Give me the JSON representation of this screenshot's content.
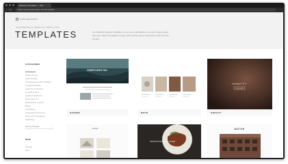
{
  "browser": {
    "tab_title": "Website Templates — Squ",
    "nav_icons": "‹ › ↻",
    "url": "https://www.squarespace.com/templates"
  },
  "header": {
    "logo_text": "SQUARESPACE",
    "eyebrow": "SQUARESPACE WEBSITE TEMPLATES",
    "title": "TEMPLATES",
    "intro": "Our beautiful designer templates, every one customizable to suit your unique needs and style. Select a template to begin, and you'll be free to customize it with your own content."
  },
  "sidebar": {
    "categories_label": "CATEGORIES",
    "items": [
      "All Designs",
      "Online Stores",
      "Artist Studios",
      "Photography & Art Portfolios",
      "Creative Portfolio",
      "Agencies & Studios",
      "Local Business",
      "Health & Wellness",
      "Personal & CV",
      "Restaurants & Food",
      "Blogs",
      "Podcasting",
      "Professional Services",
      "Personal & Weddings",
      "Weddings"
    ],
    "sort_label": "Sort by Popular",
    "sort_chevron": "⌄",
    "new_label": "NEW",
    "new_items": [
      "Popular",
      "New"
    ],
    "explore_label": "EXPLORE",
    "explore_items": [
      "Events",
      "Blog Templates"
    ]
  },
  "cards": [
    {
      "name": "HAYDEN",
      "hero_text": "STARTS WITH YOU"
    },
    {
      "name": "BOYD"
    },
    {
      "name": "GRAVITY",
      "hero_text": "GRAVITY",
      "button_text": "DISCOVER"
    },
    {
      "name": "JOHN"
    },
    {
      "name": "EMMERSON",
      "hero_text": "INSPIRATIONAL CUISINE"
    },
    {
      "name": "NATIVE",
      "hero_text": "NATIVE"
    }
  ],
  "colors": {
    "browser_chrome": "#1f1f1f",
    "header_bg": "#f2f2f2",
    "card_bg": "#f8f8f8",
    "gravity_bg": "#3d2a22"
  }
}
